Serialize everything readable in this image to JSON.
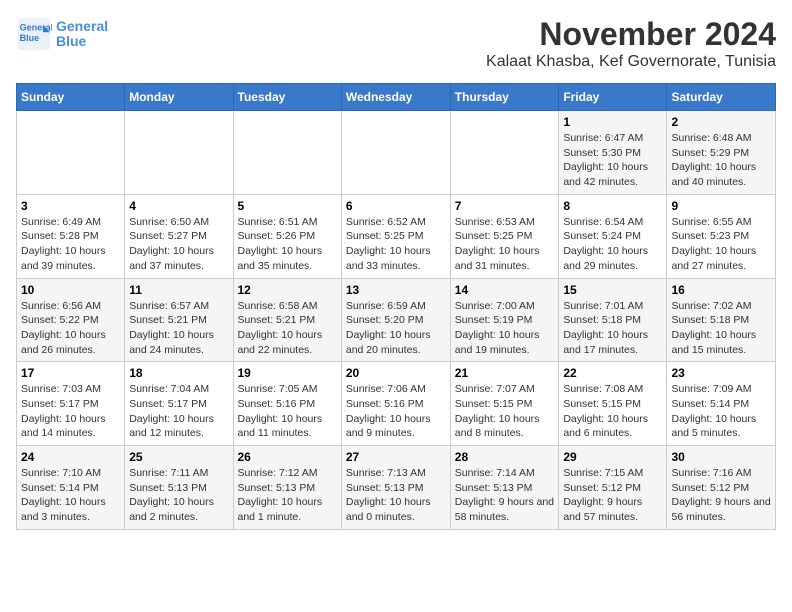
{
  "header": {
    "logo_line1": "General",
    "logo_line2": "Blue",
    "month_title": "November 2024",
    "location": "Kalaat Khasba, Kef Governorate, Tunisia"
  },
  "weekdays": [
    "Sunday",
    "Monday",
    "Tuesday",
    "Wednesday",
    "Thursday",
    "Friday",
    "Saturday"
  ],
  "weeks": [
    [
      {
        "day": "",
        "info": ""
      },
      {
        "day": "",
        "info": ""
      },
      {
        "day": "",
        "info": ""
      },
      {
        "day": "",
        "info": ""
      },
      {
        "day": "",
        "info": ""
      },
      {
        "day": "1",
        "info": "Sunrise: 6:47 AM\nSunset: 5:30 PM\nDaylight: 10 hours and 42 minutes."
      },
      {
        "day": "2",
        "info": "Sunrise: 6:48 AM\nSunset: 5:29 PM\nDaylight: 10 hours and 40 minutes."
      }
    ],
    [
      {
        "day": "3",
        "info": "Sunrise: 6:49 AM\nSunset: 5:28 PM\nDaylight: 10 hours and 39 minutes."
      },
      {
        "day": "4",
        "info": "Sunrise: 6:50 AM\nSunset: 5:27 PM\nDaylight: 10 hours and 37 minutes."
      },
      {
        "day": "5",
        "info": "Sunrise: 6:51 AM\nSunset: 5:26 PM\nDaylight: 10 hours and 35 minutes."
      },
      {
        "day": "6",
        "info": "Sunrise: 6:52 AM\nSunset: 5:25 PM\nDaylight: 10 hours and 33 minutes."
      },
      {
        "day": "7",
        "info": "Sunrise: 6:53 AM\nSunset: 5:25 PM\nDaylight: 10 hours and 31 minutes."
      },
      {
        "day": "8",
        "info": "Sunrise: 6:54 AM\nSunset: 5:24 PM\nDaylight: 10 hours and 29 minutes."
      },
      {
        "day": "9",
        "info": "Sunrise: 6:55 AM\nSunset: 5:23 PM\nDaylight: 10 hours and 27 minutes."
      }
    ],
    [
      {
        "day": "10",
        "info": "Sunrise: 6:56 AM\nSunset: 5:22 PM\nDaylight: 10 hours and 26 minutes."
      },
      {
        "day": "11",
        "info": "Sunrise: 6:57 AM\nSunset: 5:21 PM\nDaylight: 10 hours and 24 minutes."
      },
      {
        "day": "12",
        "info": "Sunrise: 6:58 AM\nSunset: 5:21 PM\nDaylight: 10 hours and 22 minutes."
      },
      {
        "day": "13",
        "info": "Sunrise: 6:59 AM\nSunset: 5:20 PM\nDaylight: 10 hours and 20 minutes."
      },
      {
        "day": "14",
        "info": "Sunrise: 7:00 AM\nSunset: 5:19 PM\nDaylight: 10 hours and 19 minutes."
      },
      {
        "day": "15",
        "info": "Sunrise: 7:01 AM\nSunset: 5:18 PM\nDaylight: 10 hours and 17 minutes."
      },
      {
        "day": "16",
        "info": "Sunrise: 7:02 AM\nSunset: 5:18 PM\nDaylight: 10 hours and 15 minutes."
      }
    ],
    [
      {
        "day": "17",
        "info": "Sunrise: 7:03 AM\nSunset: 5:17 PM\nDaylight: 10 hours and 14 minutes."
      },
      {
        "day": "18",
        "info": "Sunrise: 7:04 AM\nSunset: 5:17 PM\nDaylight: 10 hours and 12 minutes."
      },
      {
        "day": "19",
        "info": "Sunrise: 7:05 AM\nSunset: 5:16 PM\nDaylight: 10 hours and 11 minutes."
      },
      {
        "day": "20",
        "info": "Sunrise: 7:06 AM\nSunset: 5:16 PM\nDaylight: 10 hours and 9 minutes."
      },
      {
        "day": "21",
        "info": "Sunrise: 7:07 AM\nSunset: 5:15 PM\nDaylight: 10 hours and 8 minutes."
      },
      {
        "day": "22",
        "info": "Sunrise: 7:08 AM\nSunset: 5:15 PM\nDaylight: 10 hours and 6 minutes."
      },
      {
        "day": "23",
        "info": "Sunrise: 7:09 AM\nSunset: 5:14 PM\nDaylight: 10 hours and 5 minutes."
      }
    ],
    [
      {
        "day": "24",
        "info": "Sunrise: 7:10 AM\nSunset: 5:14 PM\nDaylight: 10 hours and 3 minutes."
      },
      {
        "day": "25",
        "info": "Sunrise: 7:11 AM\nSunset: 5:13 PM\nDaylight: 10 hours and 2 minutes."
      },
      {
        "day": "26",
        "info": "Sunrise: 7:12 AM\nSunset: 5:13 PM\nDaylight: 10 hours and 1 minute."
      },
      {
        "day": "27",
        "info": "Sunrise: 7:13 AM\nSunset: 5:13 PM\nDaylight: 10 hours and 0 minutes."
      },
      {
        "day": "28",
        "info": "Sunrise: 7:14 AM\nSunset: 5:13 PM\nDaylight: 9 hours and 58 minutes."
      },
      {
        "day": "29",
        "info": "Sunrise: 7:15 AM\nSunset: 5:12 PM\nDaylight: 9 hours and 57 minutes."
      },
      {
        "day": "30",
        "info": "Sunrise: 7:16 AM\nSunset: 5:12 PM\nDaylight: 9 hours and 56 minutes."
      }
    ]
  ]
}
